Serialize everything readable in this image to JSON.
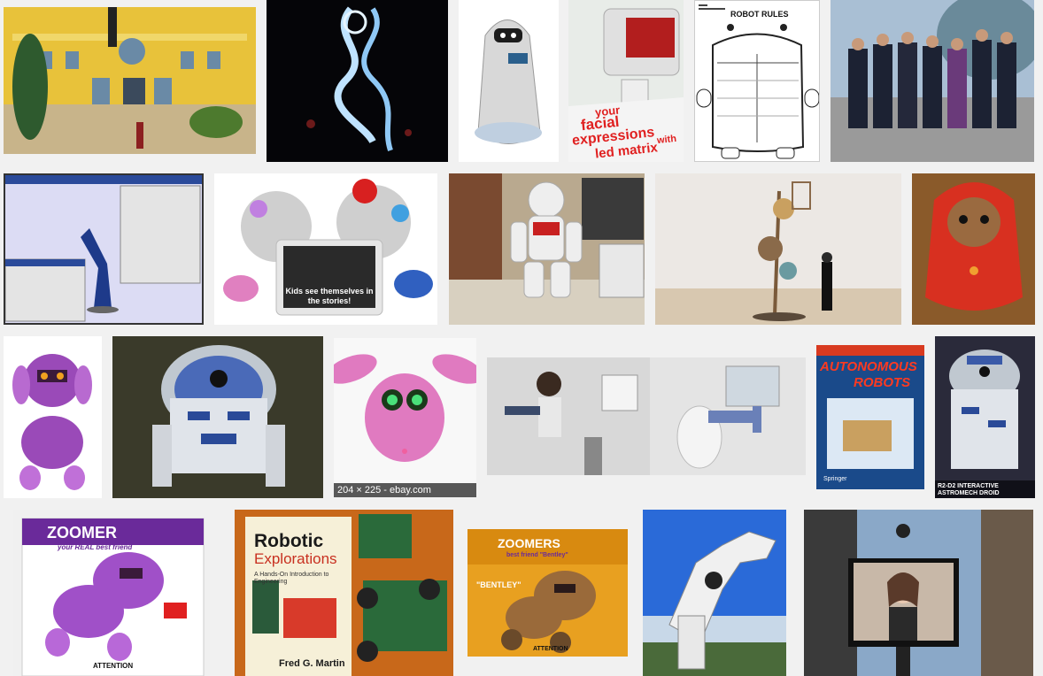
{
  "results": [
    {
      "id": "building",
      "caption": ""
    },
    {
      "id": "glow-robot-dark",
      "caption": ""
    },
    {
      "id": "white-pod-robot",
      "caption": ""
    },
    {
      "id": "led-face-robot",
      "caption": "",
      "overlay_text_1": "your",
      "overlay_text_2": "facial",
      "overlay_text_3": "expressions",
      "overlay_text_4": "with",
      "overlay_text_5": "led matrix"
    },
    {
      "id": "robot-rules-worksheet",
      "caption": "",
      "title": "ROBOT RULES"
    },
    {
      "id": "group-photo",
      "caption": ""
    },
    {
      "id": "software-arm-screenshot",
      "caption": ""
    },
    {
      "id": "plush-robots-tablet",
      "caption": "",
      "tablet_text": "Kids see themselves in the stories!"
    },
    {
      "id": "nao-robot-desk",
      "caption": ""
    },
    {
      "id": "art-sculpture-robot",
      "caption": ""
    },
    {
      "id": "et-red-hoodie",
      "caption": ""
    },
    {
      "id": "purple-robot-dog",
      "caption": ""
    },
    {
      "id": "r2d2-floor",
      "caption": ""
    },
    {
      "id": "pink-furby-robot",
      "caption": "",
      "hover_label": "204 × 225 - ebay.com"
    },
    {
      "id": "exoskeleton-arm",
      "caption": ""
    },
    {
      "id": "autonomous-robots-cover",
      "caption": "",
      "cover_title_1": "AUTONOMOUS",
      "cover_title_2": "ROBOTS",
      "publisher": "Springer"
    },
    {
      "id": "r2d2-box",
      "caption": "",
      "box_text": "R2-D2 INTERACTIVE ASTROMECH DROID"
    },
    {
      "id": "zoomer-purple-box",
      "caption": "",
      "brand": "ZOOMER",
      "tagline": "your REAL best friend",
      "warning": "ATTENTION"
    },
    {
      "id": "robotic-explorations-book",
      "caption": "",
      "book_title_1": "Robotic",
      "book_title_2": "Explorations",
      "book_subtitle": "A Hands-On Introduction to Engineering",
      "author": "Fred G. Martin"
    },
    {
      "id": "zoomer-bentley-box",
      "caption": "",
      "brand": "ZOOMERS",
      "tagline": "best friend \"Bentley\"",
      "name": "\"BENTLEY\"",
      "warning": "ATTENTION"
    },
    {
      "id": "robot-hand-sky",
      "caption": ""
    },
    {
      "id": "telepresence-screen",
      "caption": ""
    }
  ],
  "colors": {
    "page_bg": "#f1f1f1",
    "hover_label_bg": "#3c3c3c"
  }
}
